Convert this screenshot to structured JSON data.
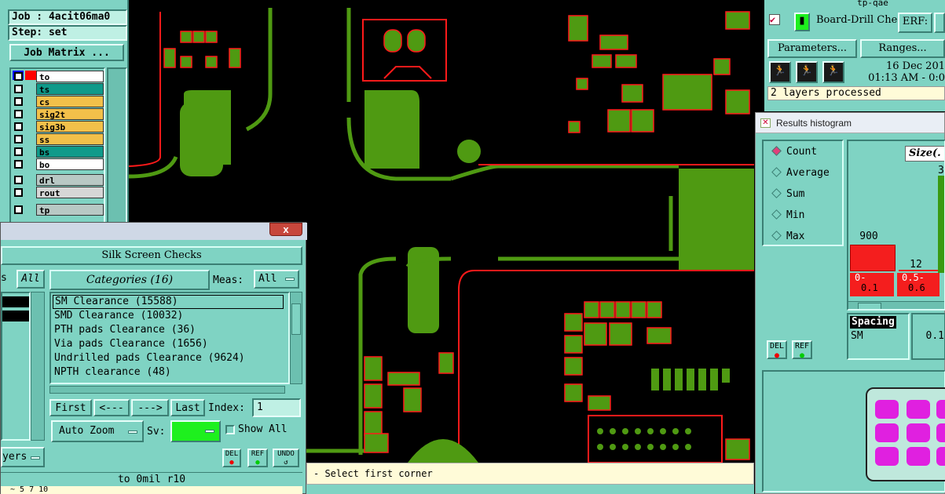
{
  "job_panel": {
    "job": "Job : 4acit06ma0",
    "step": "Step: set",
    "job_matrix_button": "Job Matrix ...",
    "layers": [
      {
        "name": "to",
        "color": "#ffffff"
      },
      {
        "name": "ts",
        "color": "#0f9a8a"
      },
      {
        "name": "cs",
        "color": "#f2c04a"
      },
      {
        "name": "sig2t",
        "color": "#f2c04a"
      },
      {
        "name": "sig3b",
        "color": "#f2c04a"
      },
      {
        "name": "ss",
        "color": "#f2c04a"
      },
      {
        "name": "bs",
        "color": "#0f9a8a"
      },
      {
        "name": "bo",
        "color": "#ffffff"
      },
      {
        "name": "drl",
        "color": "#b8c8c4"
      },
      {
        "name": "rout",
        "color": "#d6d6d6"
      },
      {
        "name": "tp",
        "color": "#b8c8c4"
      }
    ]
  },
  "right_top": {
    "title_partial": "tp-qae",
    "board_drill": "Board-Drill Che",
    "erf": "ERF:",
    "parameters": "Parameters...",
    "ranges": "Ranges...",
    "date": "16 Dec 201",
    "time": "01:13 AM - 0:0",
    "status": "2 layers processed"
  },
  "histogram": {
    "title": "Results histogram",
    "modes": [
      "Count",
      "Average",
      "Sum",
      "Min",
      "Max"
    ],
    "selected_mode": "Count",
    "size_label": "Size(.",
    "bars": [
      {
        "label": "0-\n0.1",
        "range_from": "0-",
        "range_to": "0.1",
        "count": 900,
        "count_label": "900"
      },
      {
        "label": "0.5-\n0.6",
        "range_from": "0.5-",
        "range_to": "0.6",
        "count": 12,
        "count_label": "12"
      }
    ],
    "third_bar_top": "3",
    "spacing_label": "Spacing",
    "sm_label": "SM",
    "value_partial": "0.1",
    "del_label": "DEL",
    "ref_label": "REF"
  },
  "silk": {
    "close": "x",
    "title": "Silk Screen Checks",
    "left_partial": "s",
    "all_button": "All",
    "categories_header": "Categories (16)",
    "meas_label": "Meas:",
    "meas_value": "All",
    "categories": [
      "SM Clearance (15588)",
      "SMD Clearance (10032)",
      "PTH pads Clearance (36)",
      "Via pads Clearance (1656)",
      "Undrilled pads Clearance (9624)",
      "NPTH clearance (48)"
    ],
    "selected_index": 0,
    "nav": {
      "first": "First",
      "prev": "<---",
      "next": "--->",
      "last": "Last",
      "index_label": "Index:",
      "index_value": "1"
    },
    "auto_zoom": "Auto Zoom",
    "sv_label": "Sv:",
    "show_all": "Show All",
    "layers_partial": "yers",
    "del": "DEL",
    "ref": "REF",
    "undo": "UNDO",
    "footer": "to  0mil  r10",
    "footer2": "~ 5 7 10"
  },
  "status_bar": {
    "text": "- Select first corner"
  },
  "colors": {
    "panel": "#7fd3c3",
    "copper_green": "#4f9a12",
    "outline_red": "#ff1a1a",
    "highlight_red": "#ff2020",
    "sv_green": "#1ef01e"
  }
}
